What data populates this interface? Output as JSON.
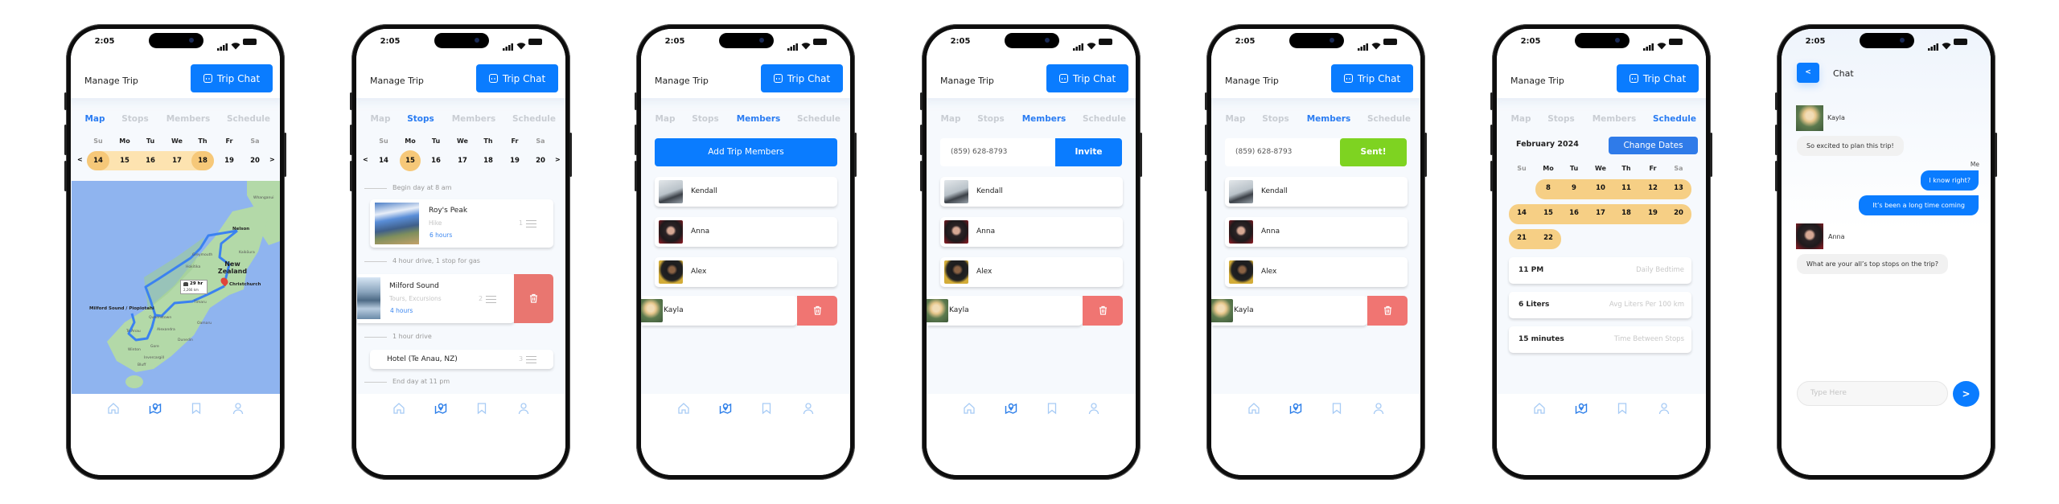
{
  "status_time": "2:05",
  "header": {
    "title": "Manage Trip",
    "chat_button": "Trip Chat"
  },
  "tabs": [
    "Map",
    "Stops",
    "Members",
    "Schedule"
  ],
  "week": {
    "prev": "<",
    "next": ">",
    "day_names": [
      "Su",
      "Mo",
      "Tu",
      "We",
      "Th",
      "Fr",
      "Sa"
    ],
    "dates": [
      "14",
      "15",
      "16",
      "17",
      "18",
      "19",
      "20"
    ]
  },
  "nav_icons": [
    "home-icon",
    "map-icon",
    "bookmark-icon",
    "user-icon"
  ],
  "colors": {
    "primary": "#0a7cff",
    "active_tab": "#2a7cf2",
    "range": "#fde3b0",
    "range_end": "#f6c879",
    "delete": "#f07572",
    "sent": "#7ed321",
    "map_water": "#8fb4ef",
    "map_land": "#b3d9a8"
  },
  "map_screen": {
    "active_tab": "Map",
    "selected_range": [
      "14",
      "18"
    ],
    "route_badge": {
      "time": "29 hr",
      "distance": "2,266 km"
    },
    "labels": [
      "Nelson",
      "Greymouth",
      "Hokitika",
      "New Zealand",
      "Kaikōura",
      "Christchurch",
      "Timaru",
      "Milford Sound / Piopiotahi",
      "Queenstown",
      "Te Anau",
      "Alexandra",
      "Oamaru",
      "Dunedin",
      "Winton",
      "Gore",
      "Invercargill",
      "Bluff",
      "Whanganui"
    ]
  },
  "stops_screen": {
    "active_tab": "Stops",
    "selected_date": "15",
    "timeline": [
      "Begin day at 8 am",
      "4 hour drive, 1 stop for gas",
      "1 hour drive",
      "End day at 11 pm"
    ],
    "stops": [
      {
        "name": "Roy's Peak",
        "type": "Hike",
        "duration": "6 hours",
        "order": "1"
      },
      {
        "name": "Milford Sound",
        "type": "Tours, Excursions",
        "duration": "4 hours",
        "order": "2"
      },
      {
        "name": "Hotel (Te Anau, NZ)",
        "order": "3"
      }
    ]
  },
  "members_screen": {
    "active_tab": "Members",
    "add_button": "Add Trip Members",
    "members": [
      "Kendall",
      "Anna",
      "Alex",
      "Kayla"
    ]
  },
  "invite_screen": {
    "phone_value": "(859) 628-8793",
    "invite_button": "Invite"
  },
  "sent_screen": {
    "phone_value": "(859) 628-8793",
    "sent_button": "Sent!"
  },
  "schedule_screen": {
    "active_tab": "Schedule",
    "month": "February 2024",
    "change_button": "Change Dates",
    "weeks": [
      [
        "",
        "8",
        "9",
        "10",
        "11",
        "12",
        "13"
      ],
      [
        "14",
        "15",
        "16",
        "17",
        "18",
        "19",
        "20"
      ],
      [
        "21",
        "22",
        "",
        "",
        "",
        "",
        ""
      ]
    ],
    "settings": [
      {
        "value": "11 PM",
        "label": "Daily Bedtime"
      },
      {
        "value": "6 Liters",
        "label": "Avg Liters Per 100 km"
      },
      {
        "value": "15 minutes",
        "label": "Time Between Stops"
      }
    ]
  },
  "chat_screen": {
    "title": "Chat",
    "back": "<",
    "me_label": "Me",
    "messages": [
      {
        "sender": "Kayla",
        "text": "So excited to plan this trip!"
      },
      {
        "sender": "Me",
        "text": "I know right?"
      },
      {
        "sender": "Me",
        "text": "It’s been a long time coming"
      },
      {
        "sender": "Anna",
        "text": "What are your all’s top stops on the trip?"
      }
    ],
    "input_placeholder": "Type Here",
    "send": ">"
  }
}
